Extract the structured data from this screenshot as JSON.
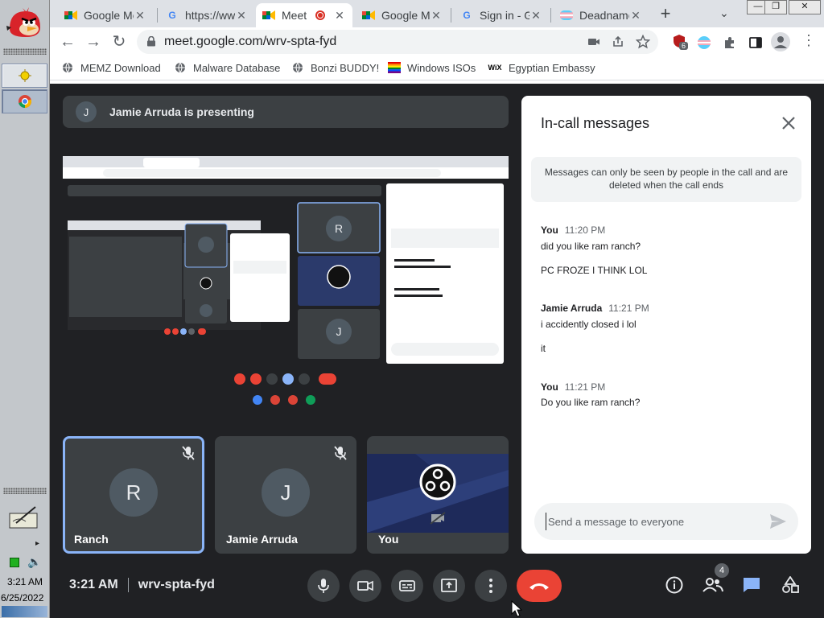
{
  "taskbar": {
    "time": "3:21 AM",
    "date": "6/25/2022"
  },
  "browser": {
    "tabs": [
      {
        "title": "Google Meet",
        "icon": "meet-icon"
      },
      {
        "title": "https://ww...",
        "icon": "google-icon"
      },
      {
        "title": "Meet",
        "icon": "meet-icon",
        "active": true
      },
      {
        "title": "Google Meet",
        "icon": "meet-icon"
      },
      {
        "title": "Sign in - Google",
        "icon": "google-icon"
      },
      {
        "title": "Deadname",
        "icon": "trans-flag-icon"
      }
    ],
    "url": "meet.google.com/wrv-spta-fyd",
    "extension_badge": "6",
    "bookmarks": [
      {
        "label": "MEMZ Download",
        "icon": "globe-icon"
      },
      {
        "label": "Malware Database",
        "icon": "globe-icon"
      },
      {
        "label": "Bonzi BUDDY!",
        "icon": "globe-icon"
      },
      {
        "label": "Windows ISOs",
        "icon": "rainbow-flag-icon"
      },
      {
        "label": "Egyptian Embassy",
        "icon": "wix-icon"
      }
    ]
  },
  "meet": {
    "presenter_initial": "J",
    "presenting_text": "Jamie Arruda is presenting",
    "participants": [
      {
        "name": "Ranch",
        "initial": "R",
        "muted": true,
        "selected": true
      },
      {
        "name": "Jamie Arruda",
        "initial": "J",
        "muted": true,
        "selected": false
      },
      {
        "name": "You",
        "initial": "",
        "muted": false,
        "selected": false
      }
    ],
    "time": "3:21 AM",
    "meeting_code": "wrv-spta-fyd",
    "people_count": "4"
  },
  "chat": {
    "title": "In-call messages",
    "notice": "Messages can only be seen by people in the call and are deleted when the call ends",
    "messages": [
      {
        "sender": "You",
        "time": "11:20 PM",
        "lines": [
          "did you like ram ranch?",
          "PC FROZE I THINK LOL"
        ]
      },
      {
        "sender": "Jamie Arruda",
        "time": "11:21 PM",
        "lines": [
          "i accidently closed i lol",
          "it"
        ]
      },
      {
        "sender": "You",
        "time": "11:21 PM",
        "lines": [
          "Do you like ram ranch?"
        ]
      }
    ],
    "input_placeholder": "Send a message to everyone"
  },
  "colors": {
    "meet_bg": "#202124",
    "tile_bg": "#3c4043",
    "end_call": "#ea4335",
    "chat_active": "#8ab4f8",
    "accent_blue": "#1a73e8"
  }
}
